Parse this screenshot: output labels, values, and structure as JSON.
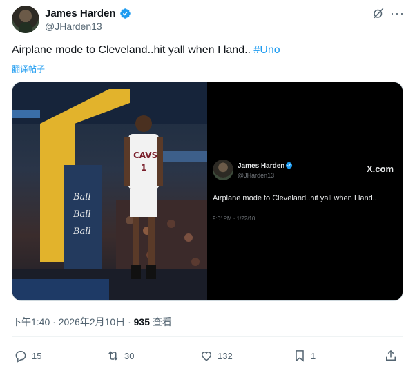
{
  "author": {
    "name": "James Harden",
    "handle": "@JHarden13"
  },
  "tweet": {
    "text": "Airplane mode to Cleveland..hit yall when I land.. ",
    "hashtag": "#Uno",
    "translate_label": "翻译帖子"
  },
  "media": {
    "left_photo": "basketball-player-hanging-on-rim",
    "right_card": {
      "name": "James Harden",
      "handle": "@JHarden13",
      "brand": "X.com",
      "text": "Airplane mode to Cleveland..hit yall when I land..",
      "time": "9:01PM · 1/22/10"
    }
  },
  "meta": {
    "timestamp": "下午1:40 · 2026年2月10日 · ",
    "views_count": "935",
    "views_label": " 查看"
  },
  "actions": {
    "replies": "15",
    "reposts": "30",
    "likes": "132",
    "bookmarks": "1"
  },
  "colors": {
    "accent": "#1d9bf0",
    "text": "#0f1419",
    "secondary": "#536471"
  }
}
